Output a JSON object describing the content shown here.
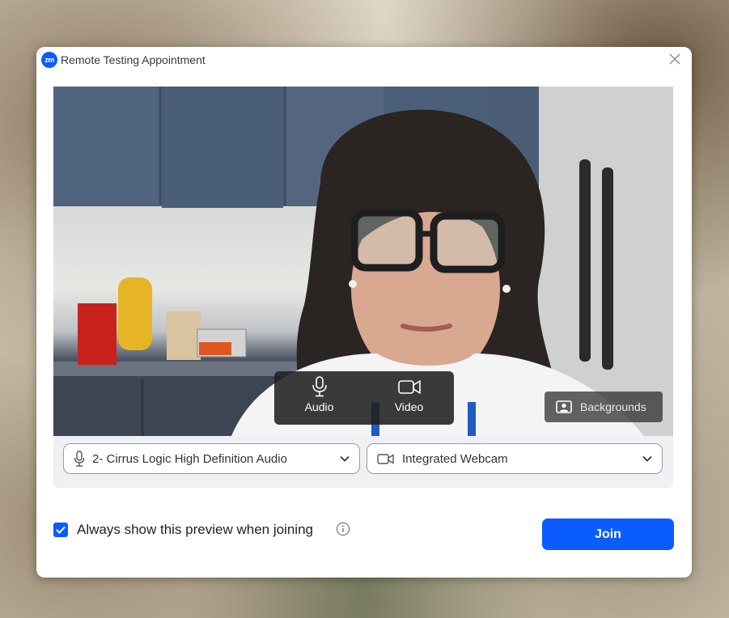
{
  "window": {
    "app_logo": "zm",
    "title": "Remote Testing Appointment",
    "close_icon": "close-icon"
  },
  "video_preview": {
    "controls": {
      "audio_label": "Audio",
      "audio_icon": "microphone-icon",
      "video_label": "Video",
      "video_icon": "video-camera-icon"
    },
    "backgrounds_label": "Backgrounds",
    "backgrounds_icon": "person-portrait-icon"
  },
  "devices": {
    "microphone": {
      "icon": "microphone-icon",
      "selected": "2- Cirrus Logic High Definition Audio"
    },
    "camera": {
      "icon": "video-camera-icon",
      "selected": "Integrated Webcam"
    }
  },
  "footer": {
    "always_show_checked": true,
    "always_show_label": "Always show this preview when joining",
    "info_icon": "info-icon",
    "join_label": "Join"
  },
  "colors": {
    "accent": "#0b5cff",
    "control_overlay": "#202020"
  }
}
